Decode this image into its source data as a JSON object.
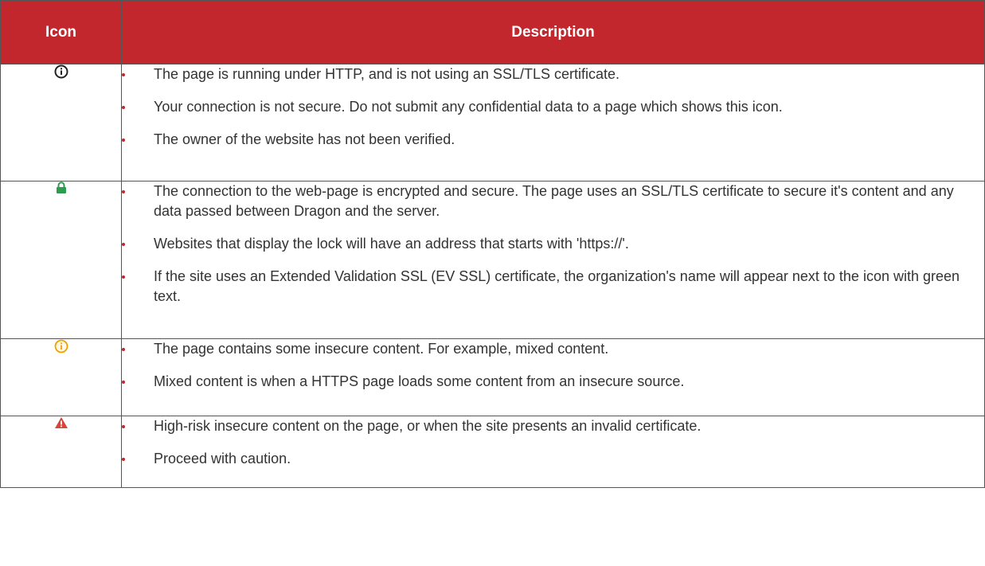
{
  "table": {
    "headers": {
      "icon": "Icon",
      "description": "Description"
    },
    "rows": [
      {
        "icon": "info-circle-icon",
        "icon_color": "#222222",
        "bullets": [
          "The page is running under HTTP, and is not using an SSL/TLS certificate.",
          "Your connection is not secure. Do not submit any confidential data to a page which shows this icon.",
          "The owner of the website has not been verified."
        ]
      },
      {
        "icon": "lock-icon",
        "icon_color": "#2e9c4e",
        "bullets": [
          "The connection to the web-page is encrypted and secure. The page uses an SSL/TLS certificate to secure it's content and any data passed between Dragon and the server.",
          "Websites that display the lock will have an address that starts with 'https://'.",
          "If the site uses an Extended Validation SSL (EV SSL) certificate, the organization's name will appear next to the icon with green text."
        ]
      },
      {
        "icon": "warning-info-circle-icon",
        "icon_color": "#f0a000",
        "bullets": [
          "The page contains some insecure content. For example, mixed content.",
          "Mixed content is when a HTTPS page loads some content from an insecure source."
        ]
      },
      {
        "icon": "danger-triangle-icon",
        "icon_color": "#d9443a",
        "bullets": [
          "High-risk insecure content on the page, or when the site presents an invalid certificate.",
          "Proceed with caution."
        ]
      }
    ]
  },
  "colors": {
    "header_background": "#c1272d",
    "header_text": "#ffffff",
    "bullet": "#c1272d",
    "border": "#555555"
  }
}
